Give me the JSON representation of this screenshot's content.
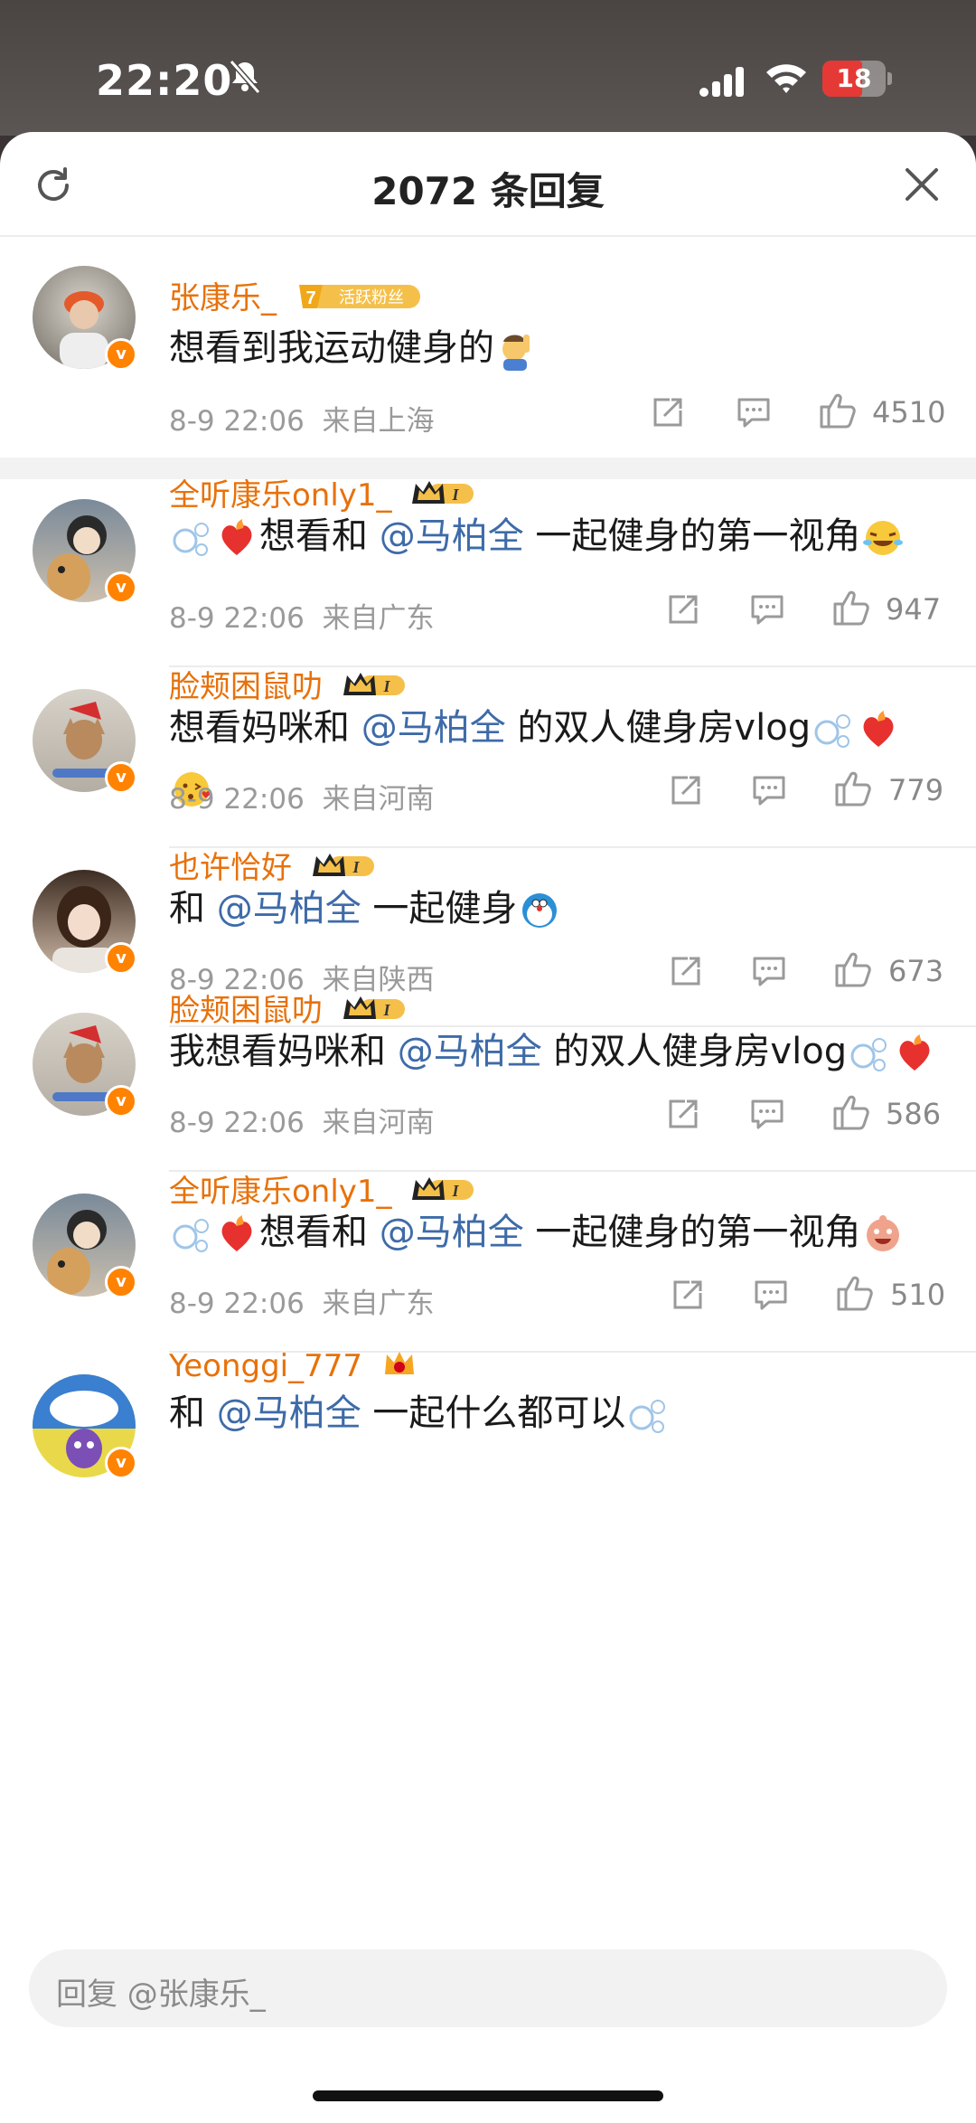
{
  "status": {
    "time": "22:20",
    "battery": "18",
    "battery_level": 0.18
  },
  "header": {
    "title": "2072 条回复"
  },
  "pinned": {
    "name": "张康乐_",
    "badge": "活跃粉丝",
    "badge_level": "7",
    "text": "想看到我运动健身的",
    "time": "8-9 22:06",
    "location": "来自上海",
    "likes": "4510"
  },
  "comments": [
    {
      "name": "全听康乐only1_",
      "prefix": "",
      "mention": "@马柏全",
      "suffix": " 一起健身的第一视角",
      "before": "想看和 ",
      "time": "8-9 22:06",
      "location": "来自广东",
      "likes": "947"
    },
    {
      "name": "脸颊困鼠叻",
      "before": "想看妈咪和 ",
      "mention": "@马柏全",
      "suffix": " 的双人健身房vlog",
      "time": "8-9 22:06",
      "location": "来自河南",
      "likes": "779"
    },
    {
      "name": "也许恰好",
      "before": "和 ",
      "mention": "@马柏全",
      "suffix": " 一起健身",
      "time": "8-9 22:06",
      "location": "来自陕西",
      "likes": "673"
    },
    {
      "name": "脸颊困鼠叻",
      "before": "我想看妈咪和 ",
      "mention": "@马柏全",
      "suffix": " 的双人健身房vlog",
      "time": "8-9 22:06",
      "location": "来自河南",
      "likes": "586"
    },
    {
      "name": "全听康乐only1_",
      "before": "想看和 ",
      "mention": "@马柏全",
      "suffix": " 一起健身的第一视角",
      "time": "8-9 22:06",
      "location": "来自广东",
      "likes": "510"
    },
    {
      "name": "Yeonggi_777",
      "before": "和 ",
      "mention": "@马柏全",
      "suffix": " 一起什么都可以",
      "time": "",
      "location": "",
      "likes": ""
    }
  ],
  "level_badge_text": "I",
  "reply": {
    "placeholder": "回复 @张康乐_"
  },
  "colors": {
    "accent": "#e8710a",
    "mention": "#3e6ba8",
    "vbadge": "#ff8200"
  }
}
